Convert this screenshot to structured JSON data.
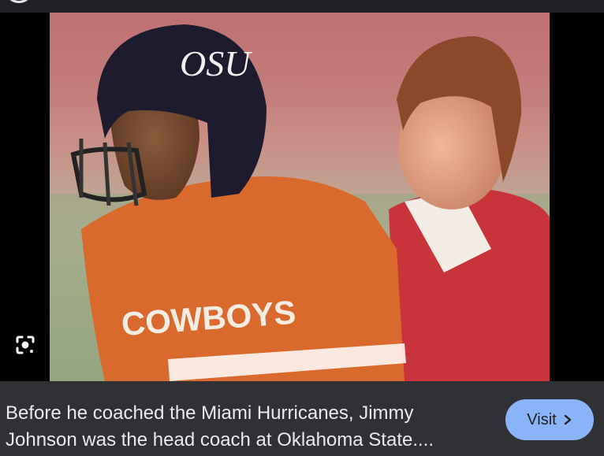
{
  "caption": {
    "line1": "Before he coached the Miami Hurricanes, Jimmy",
    "line2": "Johnson was the head coach at Oklahoma State...."
  },
  "visit": {
    "label": "Visit",
    "icon": "chevron-right-icon"
  },
  "lens": {
    "icon": "google-lens-icon"
  },
  "photo": {
    "helmet_logo": "OSU",
    "jersey_text": "COWBOYS"
  },
  "colors": {
    "background": "#202124",
    "caption_bg": "#303134",
    "text": "#e8eaed",
    "button": "#8ab4f8"
  }
}
